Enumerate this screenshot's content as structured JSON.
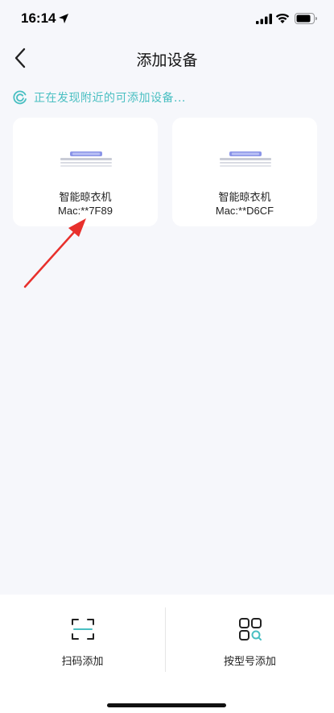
{
  "status_bar": {
    "time": "16:14",
    "icons": [
      "location-arrow-icon",
      "cellular-signal-icon",
      "wifi-icon",
      "battery-icon"
    ]
  },
  "header": {
    "title": "添加设备",
    "back_icon": "chevron-left-icon"
  },
  "scan": {
    "text": "正在发现附近的可添加设备...",
    "icon": "scanning-spinner-icon",
    "color": "#49bfc2"
  },
  "devices": [
    {
      "name": "智能晾衣机",
      "mac": "Mac:**7F89",
      "icon": "clothes-dryer-icon"
    },
    {
      "name": "智能晾衣机",
      "mac": "Mac:**D6CF",
      "icon": "clothes-dryer-icon"
    }
  ],
  "annotation": {
    "color": "#e8302c",
    "icon": "red-arrow-annotation"
  },
  "bottom_actions": [
    {
      "label": "扫码添加",
      "icon": "scan-frame-icon"
    },
    {
      "label": "按型号添加",
      "icon": "grid-search-icon"
    }
  ],
  "colors": {
    "background": "#f6f7fb",
    "card": "#ffffff",
    "accent": "#49bfc2"
  }
}
